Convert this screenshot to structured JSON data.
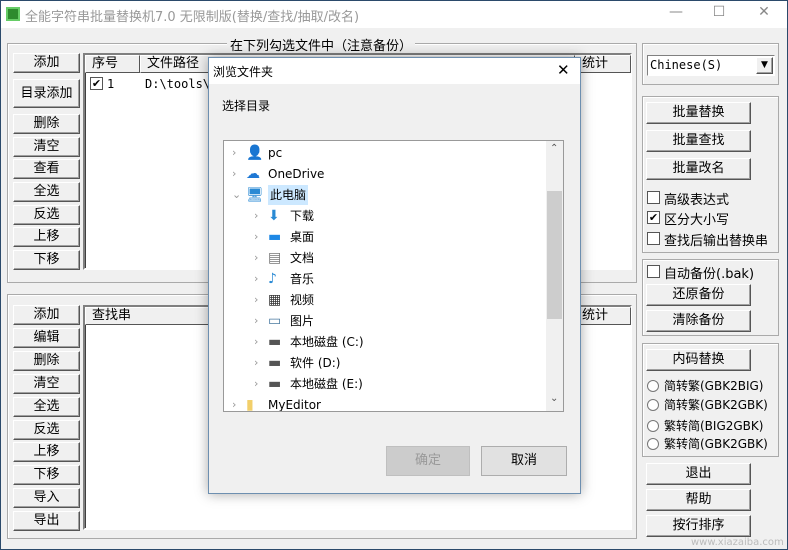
{
  "window": {
    "title": "全能字符串批量替换机7.0 无限制版(替换/查找/抽取/改名)",
    "minimize": "—",
    "maximize": "☐",
    "close": "✕"
  },
  "file_group": {
    "legend": "在下列勾选文件中（注意备份）",
    "buttons": [
      "添加",
      "目录添加",
      "删除",
      "清空",
      "查看",
      "全选",
      "反选",
      "上移",
      "下移"
    ],
    "columns": [
      "序号",
      "文件路径",
      "统计"
    ],
    "rows": [
      {
        "checked": true,
        "index": "1",
        "path": "D:\\tools\\"
      }
    ]
  },
  "search_group": {
    "buttons": [
      "添加",
      "编辑",
      "删除",
      "清空",
      "全选",
      "反选",
      "上移",
      "下移",
      "导入",
      "导出"
    ],
    "columns": [
      "查找串",
      "统计"
    ]
  },
  "language_select": {
    "value": "Chinese(S)",
    "arrow": "▼"
  },
  "actions": {
    "buttons": [
      "批量替换",
      "批量查找",
      "批量改名"
    ],
    "options": [
      {
        "label": "高级表达式",
        "checked": false
      },
      {
        "label": "区分大小写",
        "checked": true
      },
      {
        "label": "查找后输出替换串",
        "checked": false
      }
    ]
  },
  "backup": {
    "auto_label": "自动备份(.bak)",
    "auto_checked": false,
    "restore": "还原备份",
    "clear": "清除备份"
  },
  "encoding": {
    "button": "内码替换",
    "radios": [
      "简转繁(GBK2BIG)",
      "简转繁(GBK2GBK)",
      "繁转简(BIG2GBK)",
      "繁转简(GBK2GBK)"
    ]
  },
  "bottom_buttons": [
    "退出",
    "帮助",
    "按行排序"
  ],
  "dialog": {
    "title": "浏览文件夹",
    "close": "✕",
    "prompt": "选择目录",
    "tree": [
      {
        "label": "pc",
        "level": 0,
        "icon": "user-icon",
        "expanded": false
      },
      {
        "label": "OneDrive",
        "level": 0,
        "icon": "cloud-icon",
        "expanded": false
      },
      {
        "label": "此电脑",
        "level": 0,
        "icon": "computer-icon",
        "expanded": true,
        "selected": true
      },
      {
        "label": "下载",
        "level": 1,
        "icon": "download-icon"
      },
      {
        "label": "桌面",
        "level": 1,
        "icon": "desktop-icon"
      },
      {
        "label": "文档",
        "level": 1,
        "icon": "document-icon"
      },
      {
        "label": "音乐",
        "level": 1,
        "icon": "music-icon"
      },
      {
        "label": "视频",
        "level": 1,
        "icon": "video-icon"
      },
      {
        "label": "图片",
        "level": 1,
        "icon": "picture-icon"
      },
      {
        "label": "本地磁盘 (C:)",
        "level": 1,
        "icon": "drive-icon"
      },
      {
        "label": "软件 (D:)",
        "level": 1,
        "icon": "drive-icon"
      },
      {
        "label": "本地磁盘 (E:)",
        "level": 1,
        "icon": "drive-icon"
      },
      {
        "label": "MyEditor",
        "level": 0,
        "icon": "folder-icon"
      }
    ],
    "ok": "确定",
    "cancel": "取消"
  },
  "watermark": "www.xiazaiba.com"
}
